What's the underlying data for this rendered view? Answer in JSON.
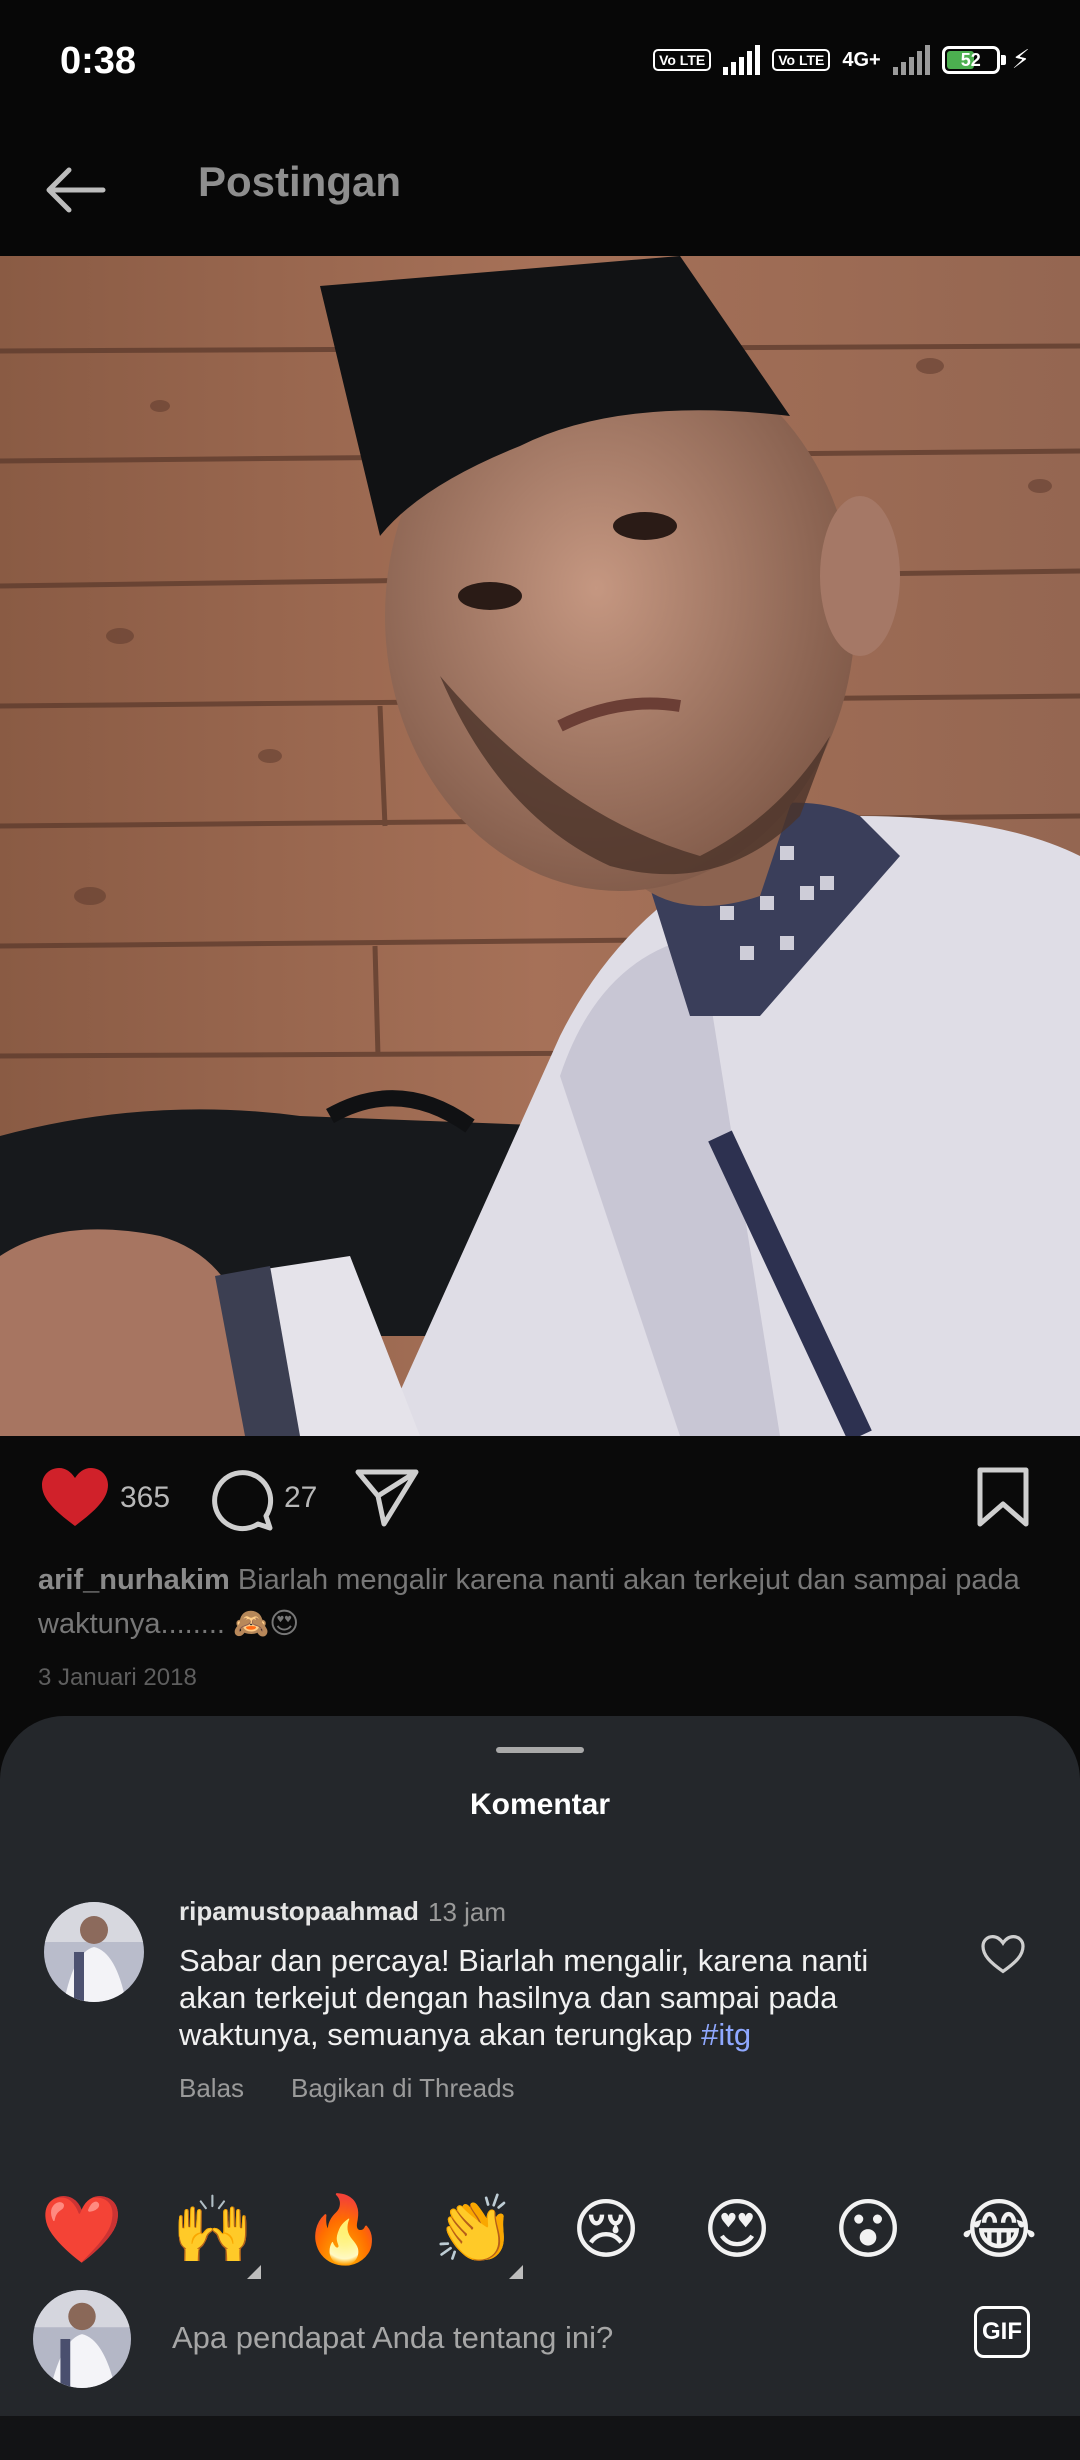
{
  "status_bar": {
    "time": "0:38",
    "volte_label": "Vo LTE",
    "network": "4G+",
    "battery": "52"
  },
  "header": {
    "title": "Postingan",
    "back_icon": "arrow-left-icon"
  },
  "post": {
    "likes": "365",
    "comments": "27",
    "caption_user": "arif_nurhakim",
    "caption_text": "Biarlah mengalir karena nanti akan terkejut dan sampai pada waktunya........ 🙈😍",
    "date": "3 Januari 2018"
  },
  "comments_sheet": {
    "title": "Komentar",
    "comment": {
      "username": "ripamustopaahmad",
      "time": "13 jam",
      "text": "Sabar dan percaya!  Biarlah mengalir, karena nanti akan terkejut dengan hasilnya dan sampai pada waktunya, semuanya akan terungkap ",
      "hashtag": "#itg",
      "reply_label": "Balas",
      "share_threads_label": "Bagikan di Threads"
    },
    "quick_emojis": [
      "❤️",
      "🙌",
      "🔥",
      "👏",
      "😢",
      "😍",
      "😮",
      "😂"
    ],
    "input_placeholder": "Apa pendapat Anda tentang ini?",
    "gif_label": "GIF"
  },
  "colors": {
    "background": "#0a0a0a",
    "sheet": "#24272b",
    "like_red": "#d0212a",
    "hashtag": "#8fa8ff"
  }
}
